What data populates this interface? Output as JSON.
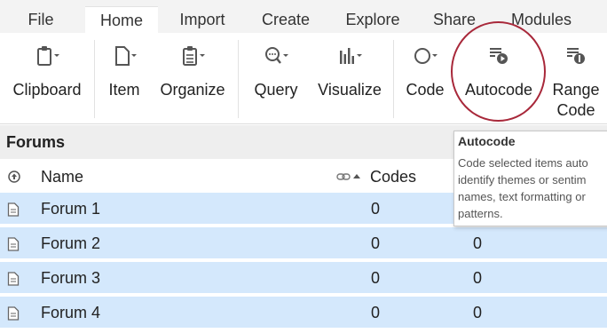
{
  "menu": {
    "tabs": [
      {
        "label": "File"
      },
      {
        "label": "Home"
      },
      {
        "label": "Import"
      },
      {
        "label": "Create"
      },
      {
        "label": "Explore"
      },
      {
        "label": "Share"
      },
      {
        "label": "Modules"
      }
    ],
    "active": "Home"
  },
  "ribbon": {
    "buttons": [
      {
        "label": "Clipboard",
        "icon": "clipboard-icon"
      },
      {
        "label": "Item",
        "icon": "document-icon"
      },
      {
        "label": "Organize",
        "icon": "organize-icon"
      },
      {
        "label": "Query",
        "icon": "query-magnifier-icon"
      },
      {
        "label": "Visualize",
        "icon": "bar-chart-icon"
      },
      {
        "label": "Code",
        "icon": "code-circle-icon"
      },
      {
        "label": "Autocode",
        "icon": "autocode-icon"
      },
      {
        "label_line1": "Range",
        "label_line2": "Code",
        "icon": "range-code-icon"
      }
    ]
  },
  "panel": {
    "title": "Forums",
    "columns": {
      "name": "Name",
      "codes": "Codes"
    },
    "rows": [
      {
        "name": "Forum 1",
        "codes": "0",
        "refs": ""
      },
      {
        "name": "Forum 2",
        "codes": "0",
        "refs": "0"
      },
      {
        "name": "Forum 3",
        "codes": "0",
        "refs": "0"
      },
      {
        "name": "Forum 4",
        "codes": "0",
        "refs": "0"
      }
    ]
  },
  "tooltip": {
    "title": "Autocode",
    "lines": [
      "Code selected items auto",
      "identify themes or sentim",
      "names, text formatting or",
      "patterns."
    ]
  },
  "colors": {
    "row_selected": "#d4e8fc",
    "highlight_ring": "#a8283a",
    "menubar_bg": "#f3f3f3"
  }
}
